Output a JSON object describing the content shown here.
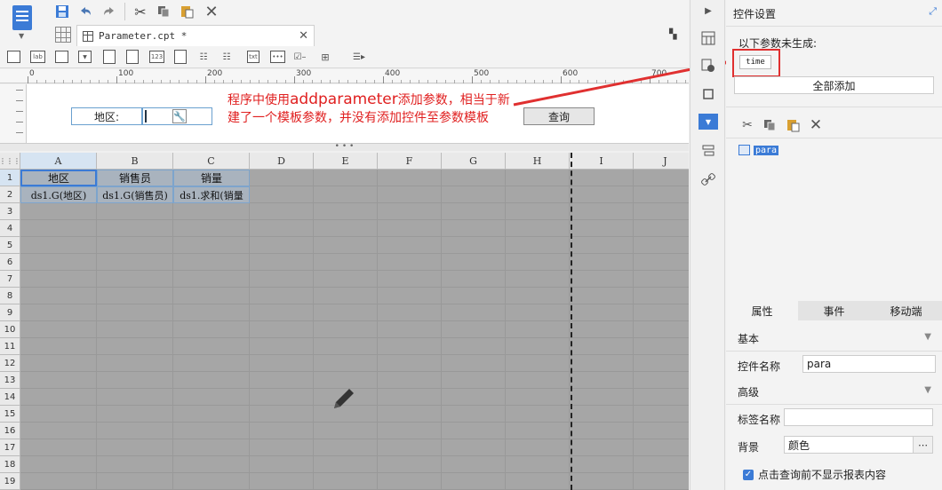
{
  "file_tab": {
    "name": "Parameter.cpt *"
  },
  "ruler": {
    "labels": [
      "0",
      "100",
      "200",
      "300",
      "400",
      "500",
      "600",
      "700"
    ]
  },
  "param_pane": {
    "region_label": "地区:",
    "query_button": "查询"
  },
  "sheet": {
    "columns": [
      "A",
      "B",
      "C",
      "D",
      "E",
      "F",
      "G",
      "H",
      "I",
      "J"
    ],
    "rows": [
      "1",
      "2",
      "3",
      "4",
      "5",
      "6",
      "7",
      "8",
      "9",
      "10",
      "11",
      "12",
      "13",
      "14",
      "15",
      "16",
      "17",
      "18",
      "19"
    ],
    "cells": {
      "A1": "地区",
      "B1": "销售员",
      "C1": "销量",
      "A2": "ds1.G(地区)",
      "B2": "ds1.G(销售员)",
      "C2": "ds1.求和(销量"
    }
  },
  "widgets": {
    "label_text": "lab",
    "txt_text": "txt",
    "num_text": "123"
  },
  "annotation": {
    "part1": "程序中使用",
    "part2": "addparameter",
    "part3": "添加参数，相当于新建了一个模板参数，并没有添加控件至参数模板"
  },
  "right_panel": {
    "title": "控件设置",
    "not_generated": "以下参数未生成:",
    "param_chip": "time",
    "add_all": "全部添加",
    "widget_item": "para",
    "tabs": [
      "属性",
      "事件",
      "移动端"
    ],
    "section_basic": "基本",
    "widget_name_label": "控件名称",
    "widget_name_value": "para",
    "section_advanced": "高级",
    "tag_name_label": "标签名称",
    "tag_name_value": "",
    "background_label": "背景",
    "background_value": "颜色",
    "checkbox_label": "点击查询前不显示报表内容"
  },
  "colors": {
    "accent": "#3b7bd6",
    "annotation": "#e02020",
    "grid_bg": "#a6a6a6"
  }
}
